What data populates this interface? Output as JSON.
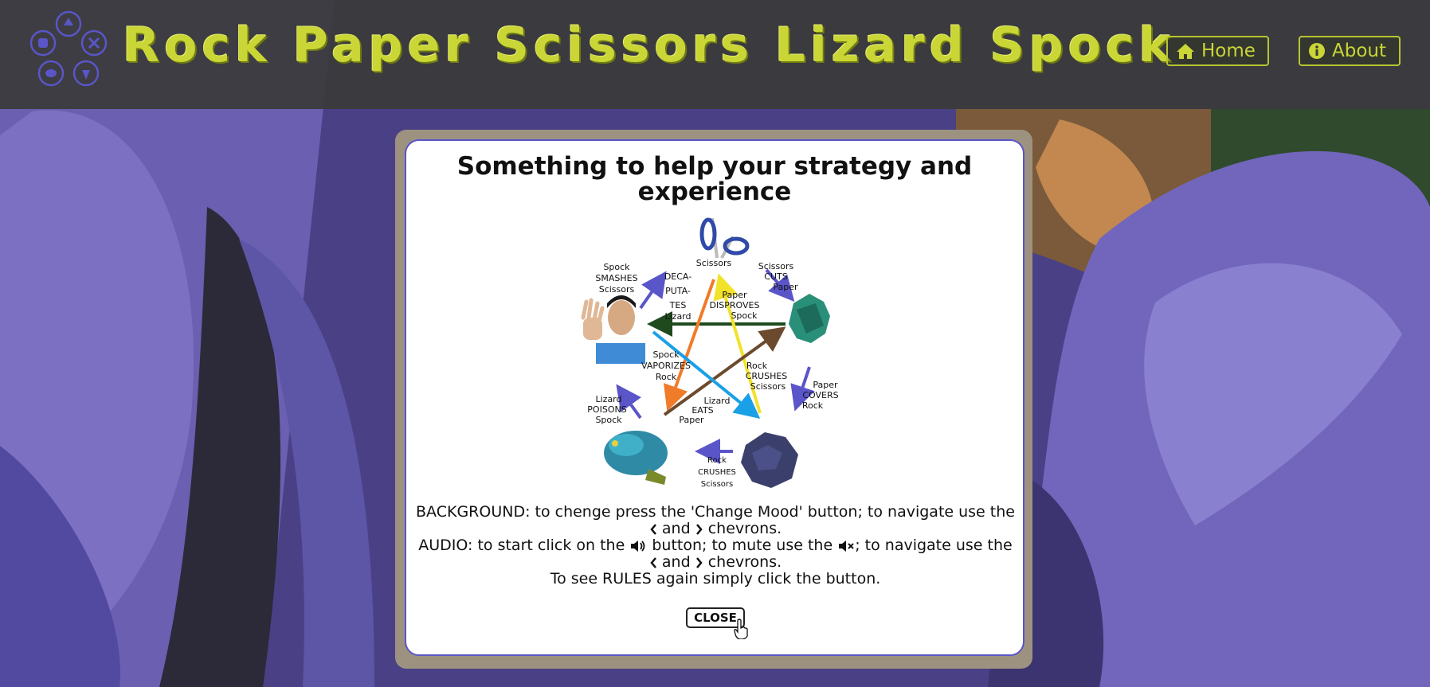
{
  "header": {
    "title": "Rock Paper Scissors Lizard Spock",
    "nav": {
      "home_label": "Home",
      "about_label": "About"
    }
  },
  "modal": {
    "title": "Something to help your strategy and experience",
    "diagram": {
      "labels": {
        "scissors": "Scissors",
        "spock_smashes": [
          "Spock",
          "SMASHES",
          "Scissors"
        ],
        "scissors_cuts": [
          "Scissors",
          "CUTS",
          "Paper"
        ],
        "decapitates": [
          "DECA-",
          "PUTA-",
          "TES",
          "Lizard"
        ],
        "paper_disproves": [
          "Paper",
          "DISPROVES",
          "Spock"
        ],
        "spock_vaporizes": [
          "Spock",
          "VAPORIZES",
          "Rock"
        ],
        "rock_crushes_center": [
          "Rock",
          "CRUSHES",
          "Scissors"
        ],
        "paper_covers": [
          "Paper",
          "COVERS",
          "Rock"
        ],
        "lizard_poisons": [
          "Lizard",
          "POISONS",
          "Spock"
        ],
        "lizard_eats": [
          "Lizard",
          "EATS",
          "Paper"
        ],
        "rock_crushes_bottom": [
          "Rock",
          "CRUSHES",
          "Scissors"
        ]
      }
    },
    "instructions": {
      "bg_part1": "BACKGROUND: to chenge press the 'Change Mood' button; to navigate use the",
      "and1": "and",
      "chevrons1": "chevrons.",
      "audio_part1": "AUDIO: to start click on the",
      "audio_part2": "button; to mute use the",
      "audio_part3": "; to navigate use the",
      "and2": "and",
      "chevrons2": "chevrons.",
      "rules": "To see RULES again simply click the button."
    },
    "close_label": "CLOSE"
  },
  "colors": {
    "accent": "#c9d636",
    "modal_border": "#5a55c8",
    "header_bg": "#3a3a3a"
  }
}
